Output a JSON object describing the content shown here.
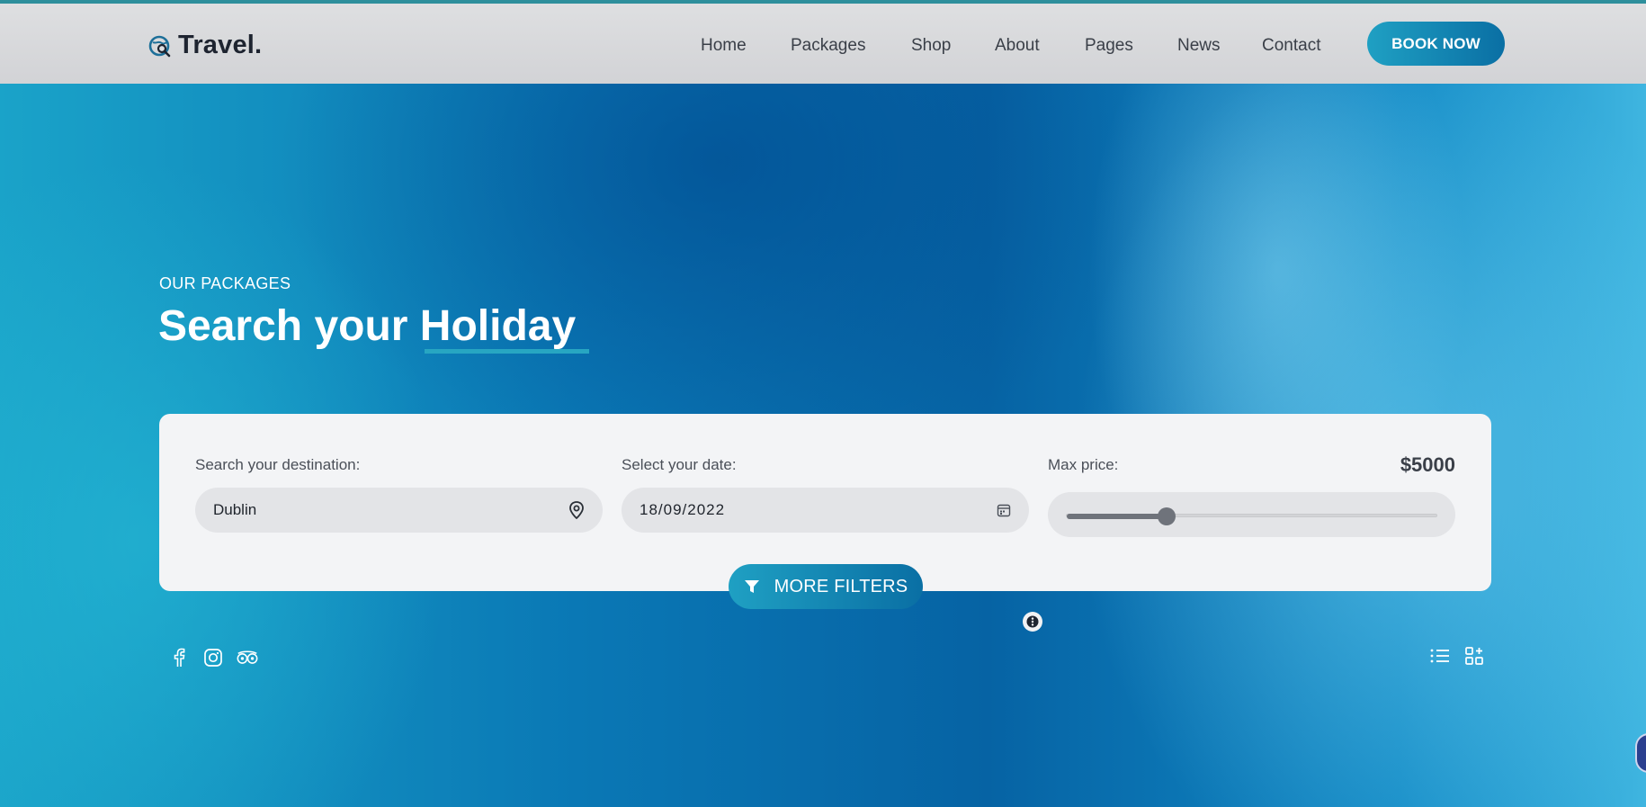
{
  "brand": {
    "name": "Travel.",
    "logo_icon": "globe-search-icon"
  },
  "nav": {
    "items": [
      "Home",
      "Packages",
      "Shop",
      "About",
      "Pages",
      "News",
      "Contact"
    ],
    "cta": "BOOK NOW"
  },
  "hero": {
    "eyebrow": "OUR PACKAGES",
    "title_plain": "Search your ",
    "title_highlight": "Holiday"
  },
  "search": {
    "destination": {
      "label": "Search your destination:",
      "value": "Dublin",
      "icon": "map-pin-icon"
    },
    "date": {
      "label": "Select your date:",
      "value": "18/09/2022",
      "icon": "calendar-icon"
    },
    "price": {
      "label": "Max price:",
      "value": "$5000",
      "slider_fraction": 0.27
    },
    "more_filters": {
      "label": "MORE FILTERS",
      "icon": "filter-icon"
    }
  },
  "social": [
    "facebook-icon",
    "instagram-icon",
    "tripadvisor-icon"
  ],
  "view_toggles": [
    "list-view-icon",
    "grid-view-icon"
  ],
  "colors": {
    "accent": "#1fa0c3",
    "accent_dark": "#0a6fa4",
    "ocean": "#0a78b5"
  }
}
